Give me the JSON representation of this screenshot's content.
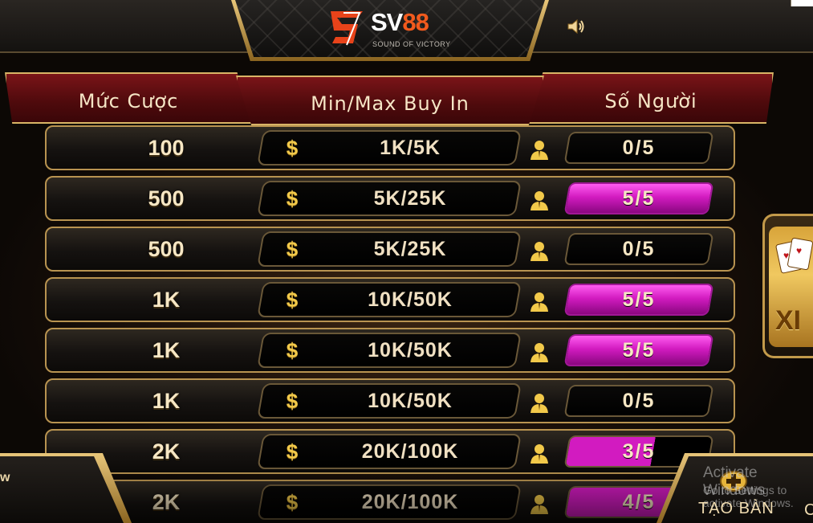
{
  "logo": {
    "brand_prefix": "SV",
    "brand_number": "88",
    "tagline": "SOUND OF VICTORY"
  },
  "header": {
    "col_bet": "Mức Cược",
    "col_buyin": "Min/Max Buy In",
    "col_players": "Số Người"
  },
  "icons": {
    "sound": "speaker-icon",
    "currency": "dollar-icon",
    "player": "person-icon",
    "create": "plus-icon"
  },
  "colors": {
    "full_room": "#d21bc0",
    "gold_accent": "#d9b466",
    "header_red": "#7a1418"
  },
  "rows": [
    {
      "bet": "100",
      "currency": "$",
      "buyin": "1K/5K",
      "players": "0/5",
      "fill": 0.0
    },
    {
      "bet": "500",
      "currency": "$",
      "buyin": "5K/25K",
      "players": "5/5",
      "fill": 1.0
    },
    {
      "bet": "500",
      "currency": "$",
      "buyin": "5K/25K",
      "players": "0/5",
      "fill": 0.0
    },
    {
      "bet": "1K",
      "currency": "$",
      "buyin": "10K/50K",
      "players": "5/5",
      "fill": 1.0
    },
    {
      "bet": "1K",
      "currency": "$",
      "buyin": "10K/50K",
      "players": "5/5",
      "fill": 1.0
    },
    {
      "bet": "1K",
      "currency": "$",
      "buyin": "10K/50K",
      "players": "0/5",
      "fill": 0.0
    },
    {
      "bet": "2K",
      "currency": "$",
      "buyin": "20K/100K",
      "players": "3/5",
      "fill": 0.6
    },
    {
      "bet": "2K",
      "currency": "$",
      "buyin": "20K/100K",
      "players": "4/5",
      "fill": 0.8
    }
  ],
  "side_card": {
    "label": "XI"
  },
  "bottom": {
    "left_label": "w",
    "create_table": "TẠO BÀN",
    "right_partial": "C"
  },
  "watermark": {
    "line1": "Activate Windows",
    "line2": "Go to Settings to activate Windows."
  }
}
